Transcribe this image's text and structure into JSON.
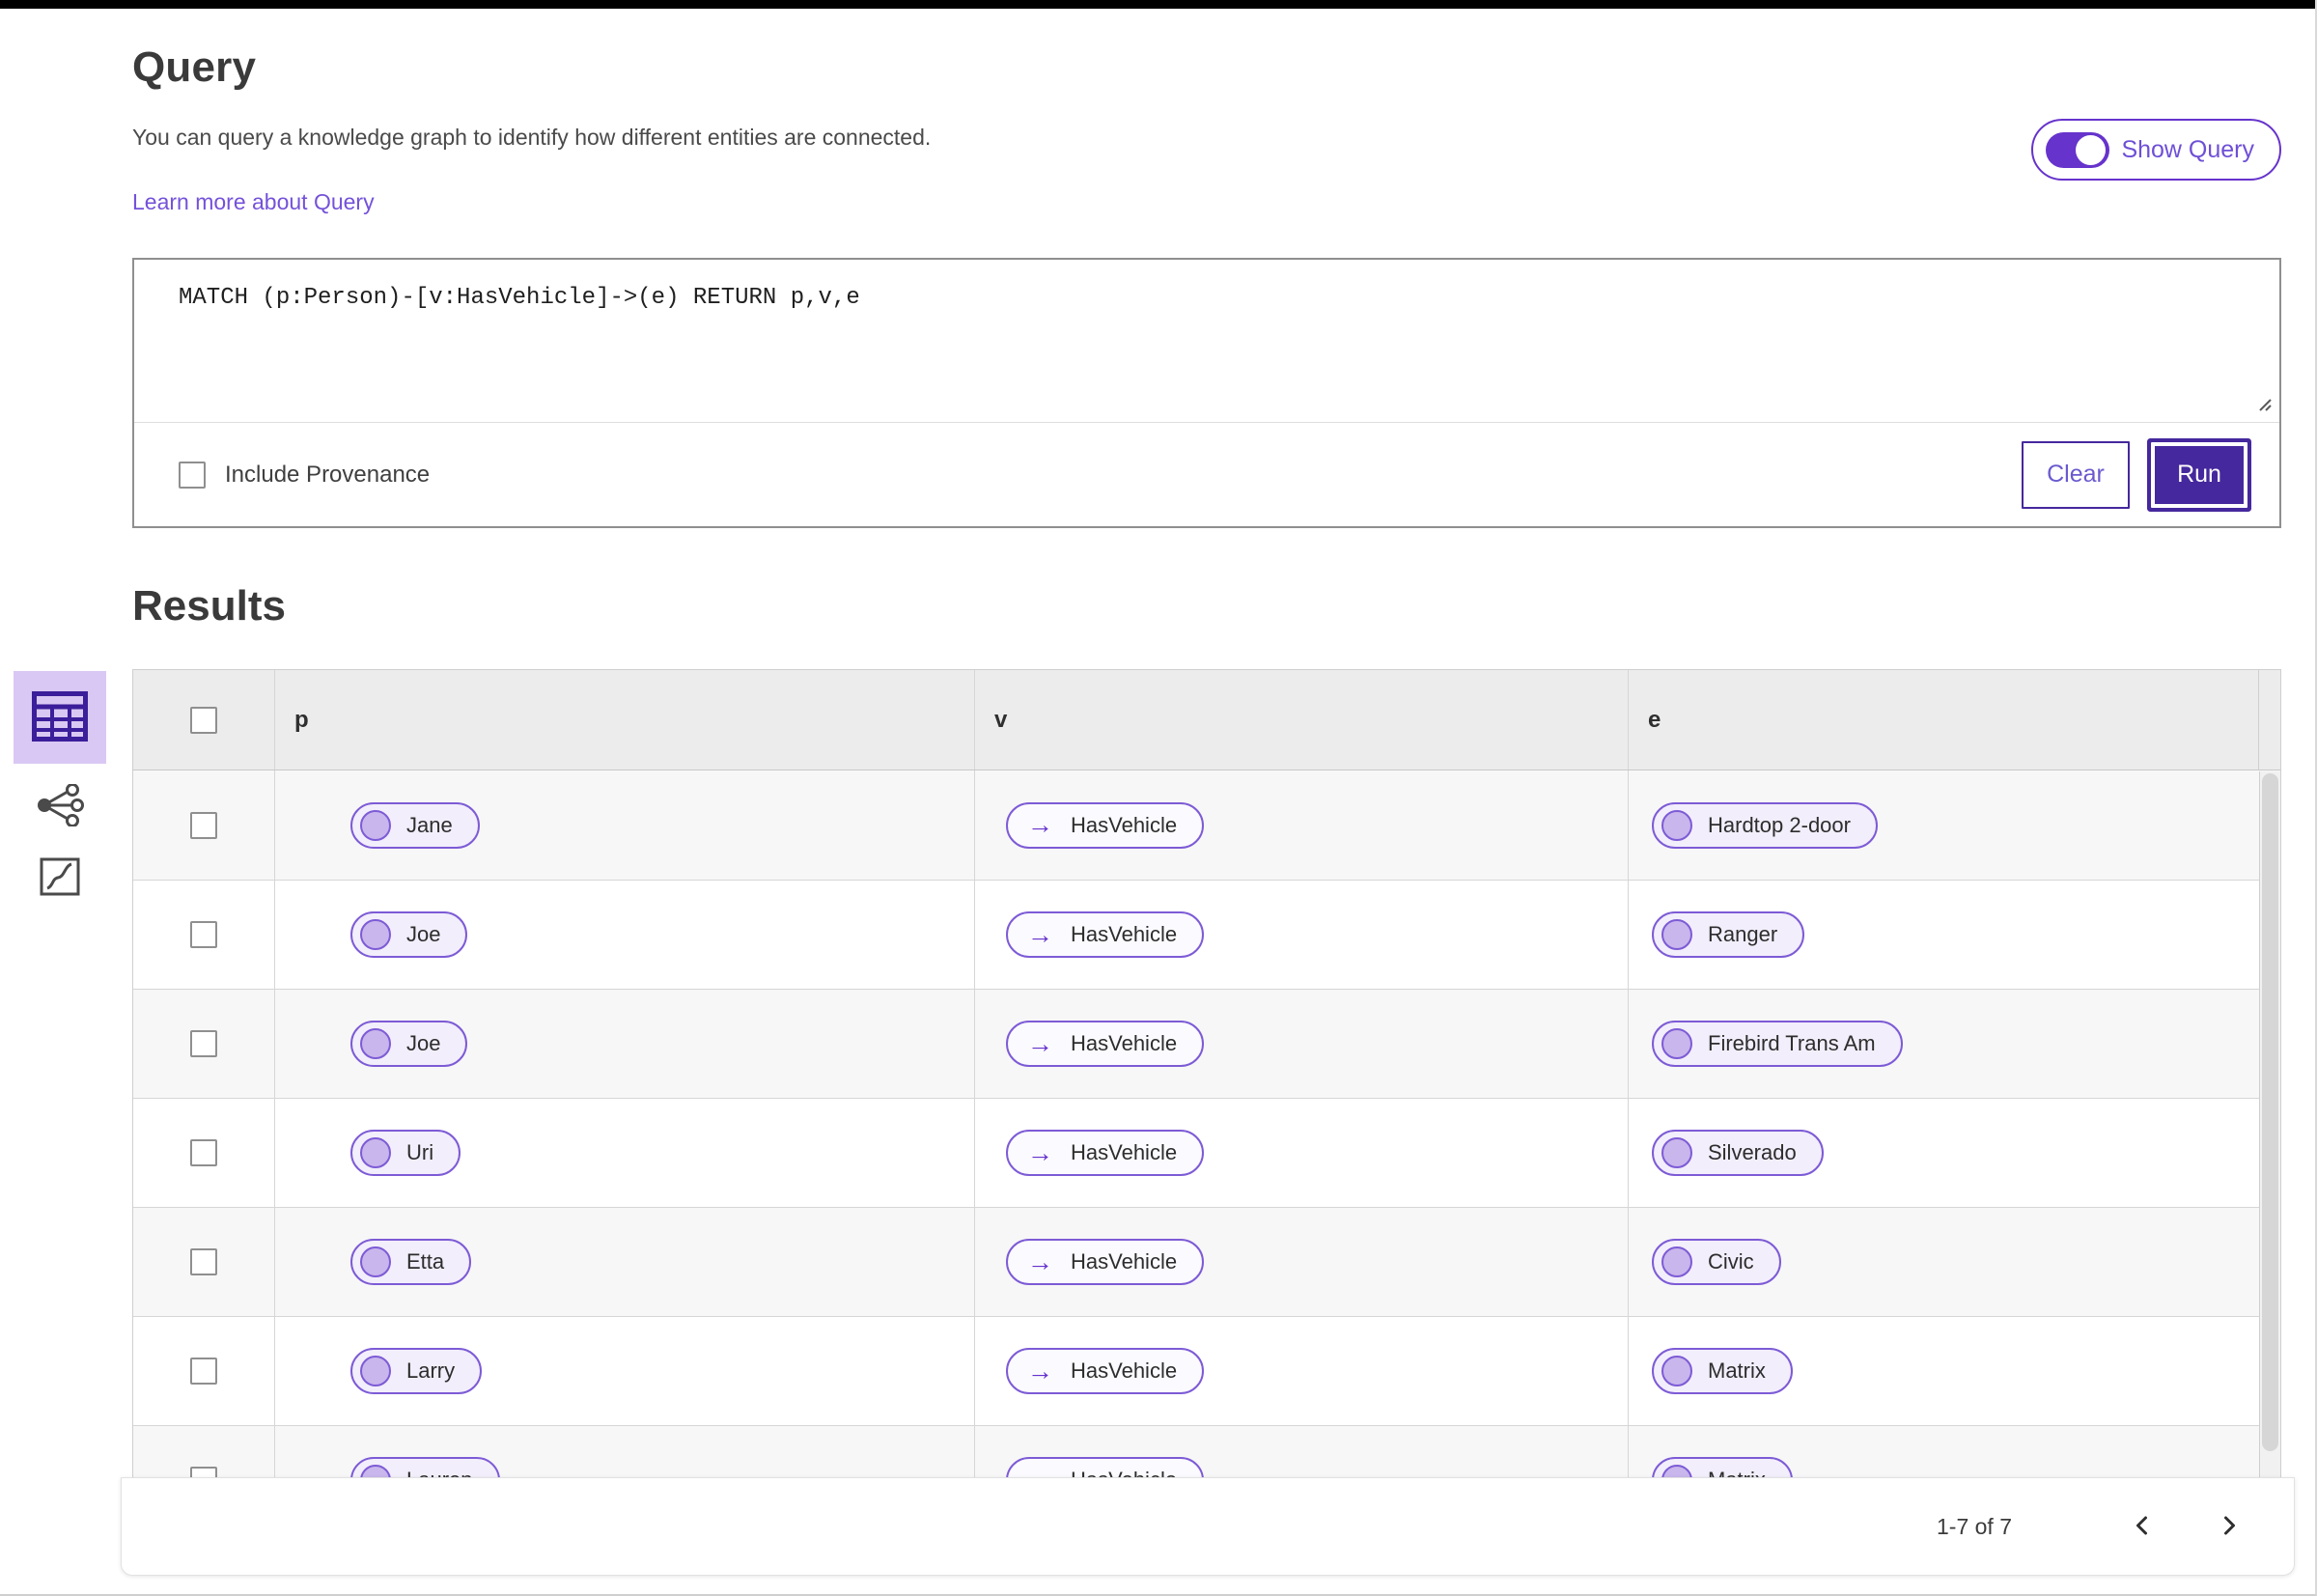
{
  "theme": {
    "accent_deep": "#45289d",
    "accent": "#6633cc",
    "accent_text": "#6e4fd6",
    "link": "#7452d9",
    "pill_border": "#7d5bd6",
    "pill_bg": "#f2eefb",
    "pill_dot": "#c9b6ec",
    "edge_pill_bg": "#fbfaff",
    "active_view_bg": "#d9c8f3"
  },
  "icons": {
    "edge_arrow": "→"
  },
  "header": {
    "title": "Query",
    "description": "You can query a knowledge graph to identify how different entities are connected.",
    "learn_more_label": "Learn more about Query",
    "show_query_label": "Show Query",
    "show_query_on": true
  },
  "editor": {
    "query_text": "MATCH (p:Person)-[v:HasVehicle]->(e) RETURN p,v,e",
    "include_provenance_label": "Include Provenance",
    "include_provenance_checked": false,
    "clear_label": "Clear",
    "run_label": "Run"
  },
  "results": {
    "heading": "Results",
    "views": [
      "table",
      "graph",
      "chart"
    ],
    "active_view": "table",
    "columns": [
      "p",
      "v",
      "e"
    ],
    "rows": [
      {
        "p": "Jane",
        "v": "HasVehicle",
        "e": "Hardtop 2-door"
      },
      {
        "p": "Joe",
        "v": "HasVehicle",
        "e": "Ranger"
      },
      {
        "p": "Joe",
        "v": "HasVehicle",
        "e": "Firebird Trans Am"
      },
      {
        "p": "Uri",
        "v": "HasVehicle",
        "e": "Silverado"
      },
      {
        "p": "Etta",
        "v": "HasVehicle",
        "e": "Civic"
      },
      {
        "p": "Larry",
        "v": "HasVehicle",
        "e": "Matrix"
      },
      {
        "p": "Lauren",
        "v": "HasVehicle",
        "e": "Matrix"
      }
    ],
    "pagination": {
      "range_label": "1-7 of 7"
    }
  }
}
